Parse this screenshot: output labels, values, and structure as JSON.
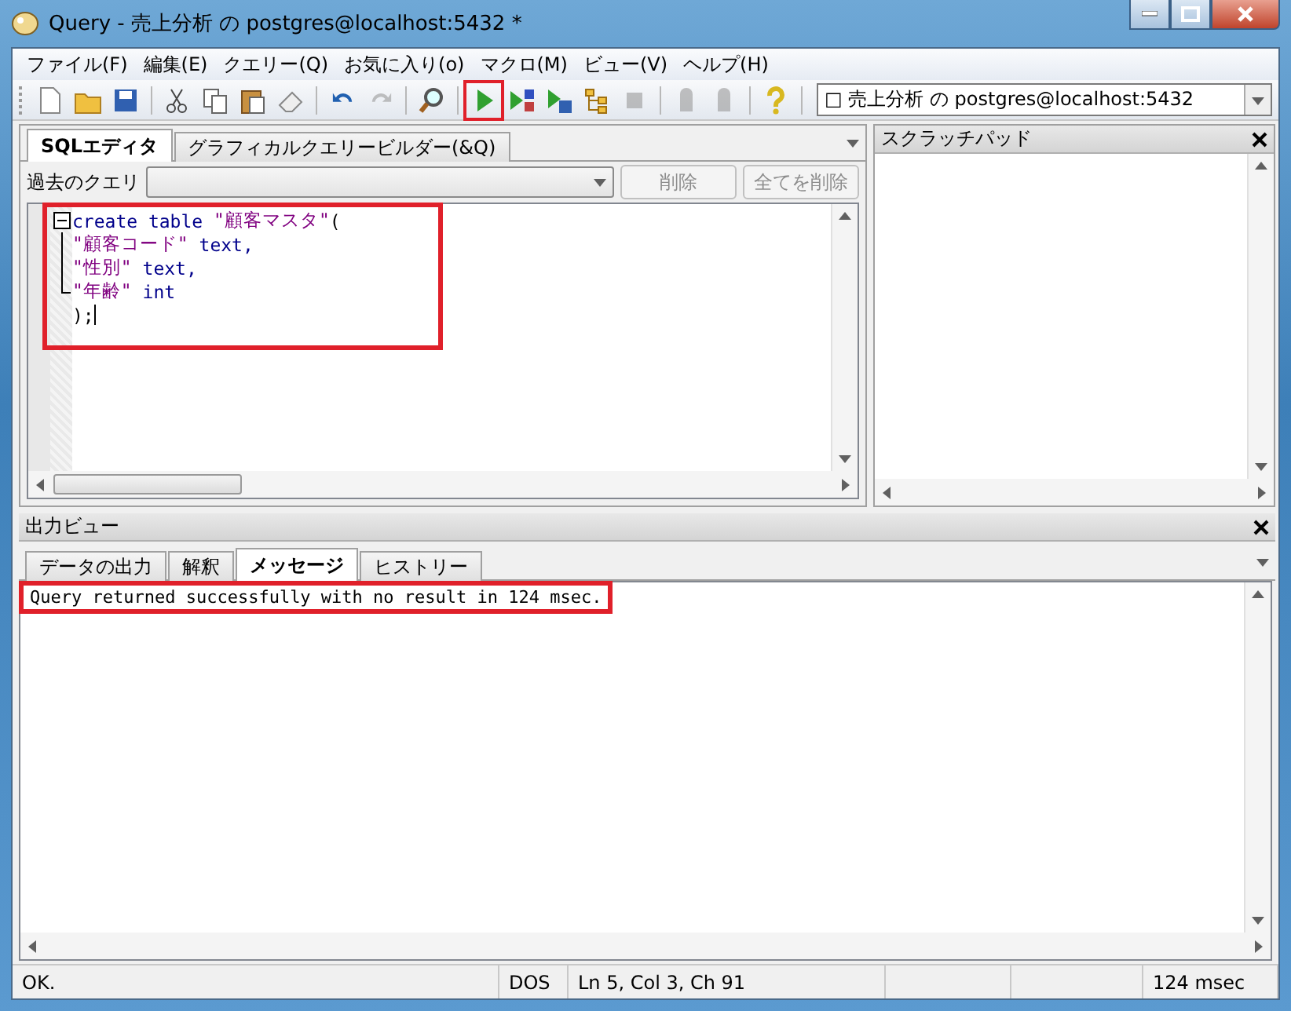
{
  "window": {
    "title": "Query - 売上分析 の postgres@localhost:5432 *"
  },
  "menu": [
    "ファイル(F)",
    "編集(E)",
    "クエリー(Q)",
    "お気に入り(o)",
    "マクロ(M)",
    "ビュー(V)",
    "ヘルプ(H)"
  ],
  "toolbar": [
    {
      "kind": "new",
      "disabled": false,
      "highlighted": false
    },
    {
      "kind": "open",
      "disabled": false,
      "highlighted": false
    },
    {
      "kind": "save",
      "disabled": false,
      "highlighted": false
    },
    {
      "kind": "sep"
    },
    {
      "kind": "cut",
      "disabled": false,
      "highlighted": false
    },
    {
      "kind": "copy",
      "disabled": false,
      "highlighted": false
    },
    {
      "kind": "paste",
      "disabled": false,
      "highlighted": false
    },
    {
      "kind": "eraser",
      "disabled": false,
      "highlighted": false
    },
    {
      "kind": "sep"
    },
    {
      "kind": "undo",
      "disabled": false,
      "highlighted": false
    },
    {
      "kind": "redo",
      "disabled": true,
      "highlighted": false
    },
    {
      "kind": "sep"
    },
    {
      "kind": "find",
      "disabled": false,
      "highlighted": false
    },
    {
      "kind": "sep"
    },
    {
      "kind": "run",
      "disabled": false,
      "highlighted": true
    },
    {
      "kind": "run-script",
      "disabled": false,
      "highlighted": false
    },
    {
      "kind": "run-save",
      "disabled": false,
      "highlighted": false
    },
    {
      "kind": "explain",
      "disabled": false,
      "highlighted": false
    },
    {
      "kind": "stop",
      "disabled": true,
      "highlighted": false
    },
    {
      "kind": "sep"
    },
    {
      "kind": "bucket",
      "disabled": true,
      "highlighted": false
    },
    {
      "kind": "bucket",
      "disabled": true,
      "highlighted": false
    },
    {
      "kind": "sep"
    },
    {
      "kind": "help",
      "disabled": false,
      "highlighted": false
    }
  ],
  "connection": {
    "value": "□ 売上分析 の postgres@localhost:5432"
  },
  "editor": {
    "tabs": [
      {
        "label": "SQLエディタ",
        "selected": true
      },
      {
        "label": "グラフィカルクエリービルダー(&Q)",
        "selected": false
      }
    ],
    "history_label": "過去のクエリ",
    "buttons": [
      {
        "label": "削除",
        "disabled": true
      },
      {
        "label": "全てを削除",
        "disabled": true
      }
    ],
    "highlighted": true,
    "lines": [
      {
        "kind": "fold-start",
        "tokens": [
          {
            "kind": "keyword",
            "text": "create table "
          },
          {
            "kind": "string",
            "text": "\"顧客マスタ\""
          },
          {
            "kind": "plain",
            "text": "("
          }
        ]
      },
      {
        "kind": "fold-line",
        "tokens": [
          {
            "kind": "string",
            "text": "\"顧客コード\""
          },
          {
            "kind": "keyword",
            "text": " text,"
          }
        ]
      },
      {
        "kind": "fold-line",
        "tokens": [
          {
            "kind": "string",
            "text": "\"性別\""
          },
          {
            "kind": "keyword",
            "text": " text,"
          }
        ]
      },
      {
        "kind": "fold-end",
        "tokens": [
          {
            "kind": "string",
            "text": "\"年齢\""
          },
          {
            "kind": "keyword",
            "text": " int"
          }
        ]
      },
      {
        "kind": "plain",
        "cursor": true,
        "tokens": [
          {
            "kind": "plain",
            "text": ");"
          }
        ]
      }
    ]
  },
  "scratchpad": {
    "title": "スクラッチパッド"
  },
  "output": {
    "title": "出力ビュー",
    "tabs": [
      {
        "label": "データの出力",
        "selected": false
      },
      {
        "label": "解釈",
        "selected": false
      },
      {
        "label": "メッセージ",
        "selected": true
      },
      {
        "label": "ヒストリー",
        "selected": false
      }
    ],
    "message": "Query returned successfully with no result in 124 msec.",
    "highlighted": true
  },
  "status_bar": [
    "OK.",
    "DOS",
    "Ln 5, Col 3, Ch 91",
    "124 msec"
  ]
}
